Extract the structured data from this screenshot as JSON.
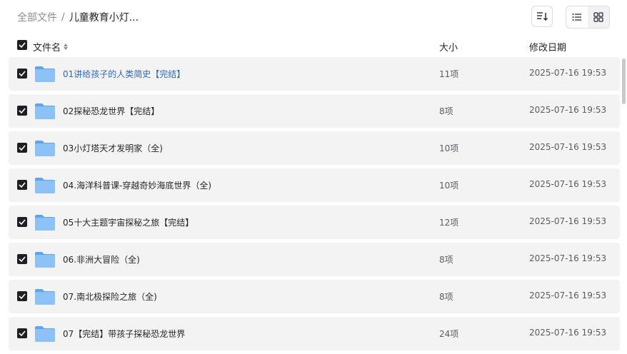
{
  "breadcrumb": {
    "root": "全部文件",
    "separator": "/",
    "current": "儿童教育小灯..."
  },
  "toolbar": {
    "sort_icon": "sort-list-icon",
    "list_icon": "list-view-icon",
    "grid_icon": "grid-view-icon",
    "active_view": "list"
  },
  "header": {
    "name": "文件名",
    "size": "大小",
    "date": "修改日期"
  },
  "rows": [
    {
      "name": "01讲给孩子的人类简史【完结】",
      "size": "11项",
      "date": "2025-07-16 19:53"
    },
    {
      "name": "02探秘恐龙世界【完结】",
      "size": "8项",
      "date": "2025-07-16 19:53"
    },
    {
      "name": "03小灯塔天才发明家（全)",
      "size": "10项",
      "date": "2025-07-16 19:53"
    },
    {
      "name": "04.海洋科普课-穿越奇妙海底世界（全)",
      "size": "10项",
      "date": "2025-07-16 19:53"
    },
    {
      "name": "05十大主题宇宙探秘之旅【完结】",
      "size": "12项",
      "date": "2025-07-16 19:53"
    },
    {
      "name": "06.非洲大冒险（全)",
      "size": "8项",
      "date": "2025-07-16 19:53"
    },
    {
      "name": "07.南北极探险之旅（全)",
      "size": "8项",
      "date": "2025-07-16 19:53"
    },
    {
      "name": "07【完结】带孩子探秘恐龙世界",
      "size": "24项",
      "date": "2025-07-16 19:53"
    }
  ],
  "colors": {
    "link": "#2b67c9",
    "row_bg": "#f3f3f4",
    "folder": "#7cb4f0",
    "checkbox": "#1d1f24"
  }
}
